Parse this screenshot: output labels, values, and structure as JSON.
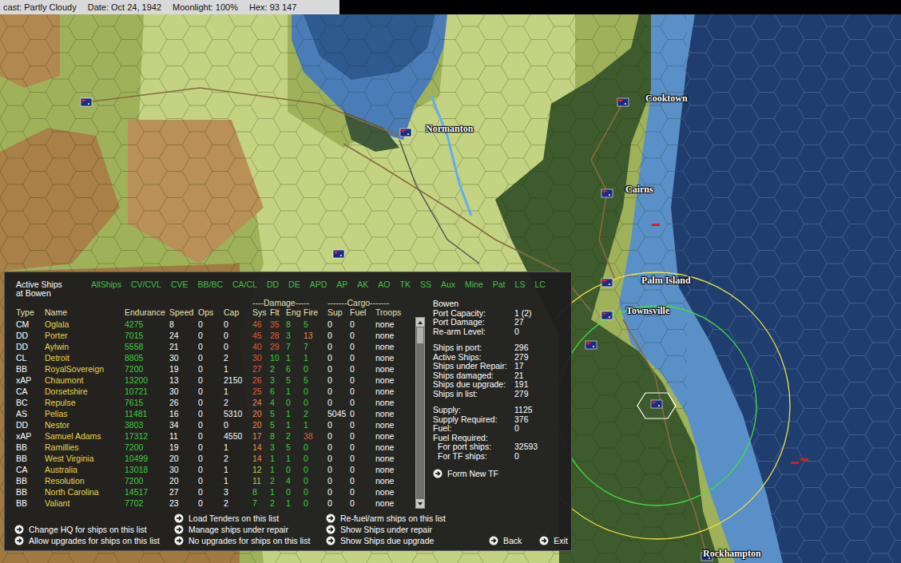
{
  "status_bar": {
    "items": [
      "cast: Partly Cloudy",
      "Date: Oct 24, 1942",
      "Moonlight: 100%",
      "Hex: 93 147"
    ]
  },
  "map": {
    "labels": [
      "Cooktown",
      "Normanton",
      "Cairns",
      "Palm Island",
      "Townsville",
      "Rockhampton"
    ]
  },
  "panel": {
    "title": "Active Ships",
    "subtitle": "at Bowen",
    "filters": [
      "AllShips",
      "CV/CVL",
      "CVE",
      "BB/BC",
      "CA/CL",
      "DD",
      "DE",
      "APD",
      "AP",
      "AK",
      "AO",
      "TK",
      "SS",
      "Aux",
      "Mine",
      "Pat",
      "LS",
      "LC"
    ],
    "table": {
      "group_headers": [
        "----Damage-----",
        "-------Cargo-------"
      ],
      "columns": [
        "Type",
        "Name",
        "Endurance",
        "Speed",
        "Ops",
        "Cap",
        "Sys",
        "Flt",
        "Eng",
        "Fire",
        "Sup",
        "Fuel",
        "Troops"
      ],
      "rows": [
        {
          "type": "CM",
          "name": "Oglala",
          "endurance": "4275",
          "speed": "8",
          "ops": "0",
          "cap": "0",
          "sys": "46",
          "flt": "35",
          "eng": "8",
          "fire": "5",
          "sup": "0",
          "fuel": "0",
          "troops": "none"
        },
        {
          "type": "DD",
          "name": "Porter",
          "endurance": "7015",
          "speed": "24",
          "ops": "0",
          "cap": "0",
          "sys": "45",
          "flt": "28",
          "eng": "3",
          "fire": "13",
          "sup": "0",
          "fuel": "0",
          "troops": "none"
        },
        {
          "type": "DD",
          "name": "Aylwin",
          "endurance": "5558",
          "speed": "21",
          "ops": "0",
          "cap": "0",
          "sys": "40",
          "flt": "29",
          "eng": "7",
          "fire": "7",
          "sup": "0",
          "fuel": "0",
          "troops": "none"
        },
        {
          "type": "CL",
          "name": "Detroit",
          "endurance": "8805",
          "speed": "30",
          "ops": "0",
          "cap": "2",
          "sys": "30",
          "flt": "10",
          "eng": "1",
          "fire": "1",
          "sup": "0",
          "fuel": "0",
          "troops": "none"
        },
        {
          "type": "BB",
          "name": "RoyalSovereign",
          "endurance": "7200",
          "speed": "19",
          "ops": "0",
          "cap": "1",
          "sys": "27",
          "flt": "2",
          "eng": "6",
          "fire": "0",
          "sup": "0",
          "fuel": "0",
          "troops": "none"
        },
        {
          "type": "xAP",
          "name": "Chaumont",
          "endurance": "13200",
          "speed": "13",
          "ops": "0",
          "cap": "2150",
          "sys": "26",
          "flt": "3",
          "eng": "5",
          "fire": "5",
          "sup": "0",
          "fuel": "0",
          "troops": "none"
        },
        {
          "type": "CA",
          "name": "Dorsetshire",
          "endurance": "10721",
          "speed": "30",
          "ops": "0",
          "cap": "1",
          "sys": "25",
          "flt": "6",
          "eng": "1",
          "fire": "0",
          "sup": "0",
          "fuel": "0",
          "troops": "none"
        },
        {
          "type": "BC",
          "name": "Repulse",
          "endurance": "7615",
          "speed": "26",
          "ops": "0",
          "cap": "2",
          "sys": "24",
          "flt": "4",
          "eng": "0",
          "fire": "0",
          "sup": "0",
          "fuel": "0",
          "troops": "none"
        },
        {
          "type": "AS",
          "name": "Pelias",
          "endurance": "11481",
          "speed": "16",
          "ops": "0",
          "cap": "5310",
          "sys": "20",
          "flt": "5",
          "eng": "1",
          "fire": "2",
          "sup": "5045",
          "fuel": "0",
          "troops": "none"
        },
        {
          "type": "DD",
          "name": "Nestor",
          "endurance": "3803",
          "speed": "34",
          "ops": "0",
          "cap": "0",
          "sys": "20",
          "flt": "5",
          "eng": "1",
          "fire": "1",
          "sup": "0",
          "fuel": "0",
          "troops": "none"
        },
        {
          "type": "xAP",
          "name": "Samuel Adams",
          "endurance": "17312",
          "speed": "11",
          "ops": "0",
          "cap": "4550",
          "sys": "17",
          "flt": "8",
          "eng": "2",
          "fire": "38",
          "sup": "0",
          "fuel": "0",
          "troops": "none"
        },
        {
          "type": "BB",
          "name": "Ramillies",
          "endurance": "7200",
          "speed": "19",
          "ops": "0",
          "cap": "1",
          "sys": "14",
          "flt": "3",
          "eng": "5",
          "fire": "0",
          "sup": "0",
          "fuel": "0",
          "troops": "none"
        },
        {
          "type": "BB",
          "name": "West Virginia",
          "endurance": "10499",
          "speed": "20",
          "ops": "0",
          "cap": "2",
          "sys": "14",
          "flt": "1",
          "eng": "1",
          "fire": "0",
          "sup": "0",
          "fuel": "0",
          "troops": "none"
        },
        {
          "type": "CA",
          "name": "Australia",
          "endurance": "13018",
          "speed": "30",
          "ops": "0",
          "cap": "1",
          "sys": "12",
          "flt": "1",
          "eng": "0",
          "fire": "0",
          "sup": "0",
          "fuel": "0",
          "troops": "none"
        },
        {
          "type": "BB",
          "name": "Resolution",
          "endurance": "7200",
          "speed": "20",
          "ops": "0",
          "cap": "1",
          "sys": "11",
          "flt": "2",
          "eng": "4",
          "fire": "0",
          "sup": "0",
          "fuel": "0",
          "troops": "none"
        },
        {
          "type": "BB",
          "name": "North Carolina",
          "endurance": "14517",
          "speed": "27",
          "ops": "0",
          "cap": "3",
          "sys": "8",
          "flt": "1",
          "eng": "0",
          "fire": "0",
          "sup": "0",
          "fuel": "0",
          "troops": "none"
        },
        {
          "type": "BB",
          "name": "Valiant",
          "endurance": "7702",
          "speed": "23",
          "ops": "0",
          "cap": "2",
          "sys": "7",
          "flt": "2",
          "eng": "1",
          "fire": "0",
          "sup": "0",
          "fuel": "0",
          "troops": "none"
        }
      ]
    },
    "info": {
      "title": "Bowen",
      "groups": [
        [
          {
            "label": "Port Capacity:",
            "value": "1 (2)",
            "indent": false
          },
          {
            "label": "Port Damage:",
            "value": "27",
            "indent": false
          },
          {
            "label": "Re-arm Level:",
            "value": "0",
            "indent": false
          }
        ],
        [
          {
            "label": "Ships in port:",
            "value": "296",
            "indent": false
          },
          {
            "label": "Active Ships:",
            "value": "279",
            "indent": false
          },
          {
            "label": "Ships under Repair:",
            "value": "17",
            "indent": false
          },
          {
            "label": "Ships damaged:",
            "value": "21",
            "indent": false
          },
          {
            "label": "Ships due upgrade:",
            "value": "191",
            "indent": false
          },
          {
            "label": "Ships in list:",
            "value": "279",
            "indent": false
          }
        ],
        [
          {
            "label": "Supply:",
            "value": "1125",
            "indent": false
          },
          {
            "label": "Supply Required:",
            "value": "376",
            "indent": false
          },
          {
            "label": "Fuel:",
            "value": "0",
            "indent": false
          },
          {
            "label": "Fuel Required:",
            "value": "",
            "indent": false
          },
          {
            "label": "For port ships:",
            "value": "32593",
            "indent": true
          },
          {
            "label": "For TF ships:",
            "value": "0",
            "indent": true
          }
        ]
      ],
      "form_button": "Form New TF"
    },
    "buttons": {
      "columns": [
        [
          "Change HQ for ships on this list",
          "Allow upgrades for ships on this list"
        ],
        [
          "Load Tenders on this list",
          "Manage ships under repair",
          "No upgrades for ships on this list"
        ],
        [
          "Re-fuel/arm ships on this list",
          "Show Ships under repair",
          "Show Ships due upgrade"
        ]
      ],
      "nav": [
        "Back",
        "Exit"
      ]
    }
  }
}
